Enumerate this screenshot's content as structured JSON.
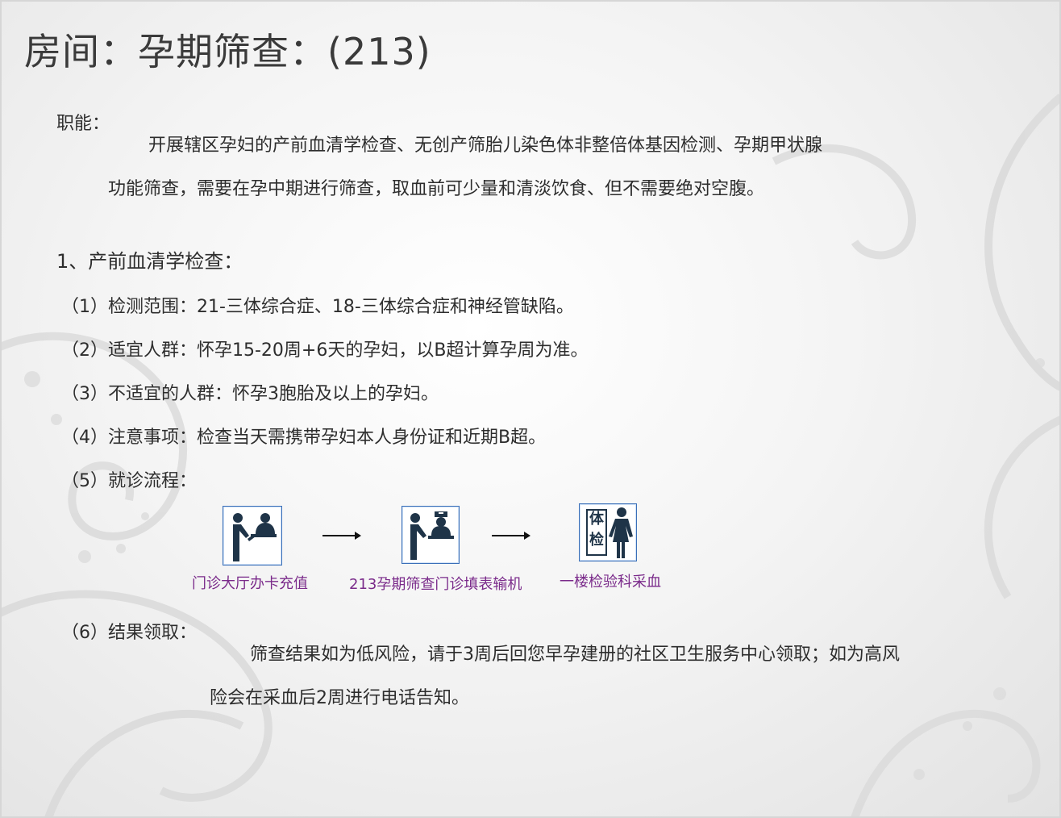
{
  "title": "房间：孕期筛查：(213)",
  "function": {
    "label": "职能：",
    "line1": "开展辖区孕妇的产前血清学检查、无创产筛胎儿染色体非整倍体基因检测、孕期甲状腺",
    "line2": "功能筛查，需要在孕中期进行筛查，取血前可少量和清淡饮食、但不需要绝对空腹。"
  },
  "section1": {
    "heading": "1、产前血清学检查：",
    "items": [
      "（1）检测范围：21-三体综合症、18-三体综合症和神经管缺陷。",
      "（2）适宜人群：怀孕15-20周+6天的孕妇，以B超计算孕周为准。",
      "（3）不适宜的人群：怀孕3胞胎及以上的孕妇。",
      "（4）注意事项：检查当天需携带孕妇本人身份证和近期B超。",
      "（5）就诊流程："
    ]
  },
  "flow": {
    "steps": [
      {
        "label": "门诊大厅办卡充值",
        "icon": "service-counter-icon"
      },
      {
        "label": "213孕期筛查门诊填表输机",
        "icon": "doctor-desk-icon"
      },
      {
        "label": "一楼检验科采血",
        "icon": "physical-exam-icon",
        "icon_text": [
          "体",
          "检"
        ]
      }
    ]
  },
  "result": {
    "label": "（6）结果领取：",
    "line1": "筛查结果如为低风险，请于3周后回您早孕建册的社区卫生服务中心领取；如为高风",
    "line2": "险会在采血后2周进行电话告知。"
  },
  "colors": {
    "flow_label": "#7a2a8a",
    "icon_border": "#3a6fb8",
    "icon_figure": "#1f3448"
  }
}
